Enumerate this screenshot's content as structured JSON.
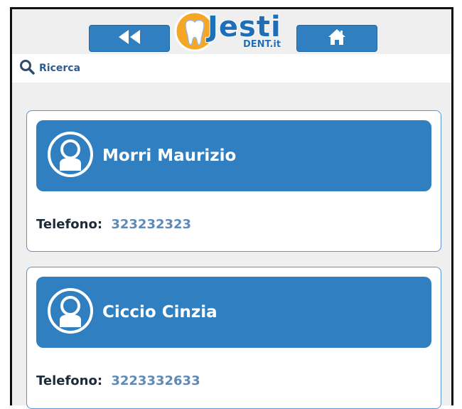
{
  "header": {
    "back_icon": "rewind-icon",
    "home_icon": "home-icon",
    "logo_text": "Jesti",
    "logo_sub": "DENT.it",
    "brand_color": "#2f7fc1"
  },
  "search": {
    "label": "Ricerca",
    "icon": "search-icon"
  },
  "contacts": [
    {
      "name": "Morri Maurizio",
      "phone_label": "Telefono:",
      "phone": "323232323"
    },
    {
      "name": "Ciccio Cinzia",
      "phone_label": "Telefono:",
      "phone": "3223332633"
    }
  ]
}
